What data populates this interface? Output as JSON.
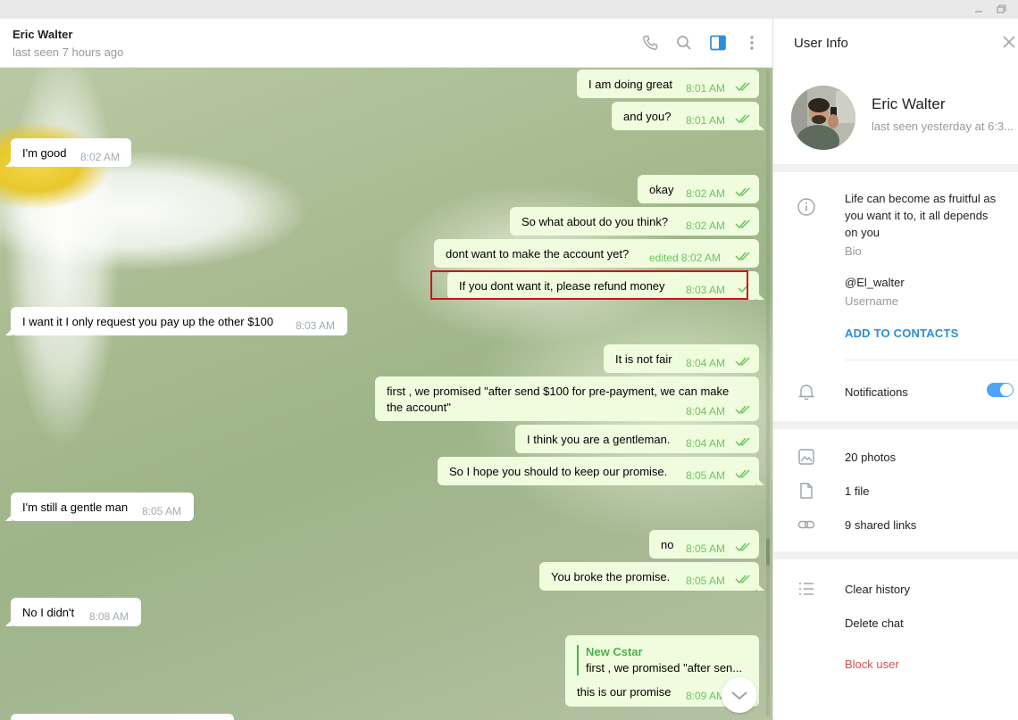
{
  "window": {
    "minimize_icon": "minimize-icon",
    "restore_icon": "restore-icon"
  },
  "chat_header": {
    "name": "Eric Walter",
    "status": "last seen 7 hours ago",
    "icons": [
      "phone-icon",
      "search-icon",
      "sidebar-toggle-icon",
      "more-vertical-icon"
    ]
  },
  "messages": [
    {
      "dir": "out",
      "text": "I am doing great",
      "time": "8:01 AM",
      "read": true
    },
    {
      "dir": "out",
      "text": "and  you?",
      "time": "8:01 AM",
      "read": true
    },
    {
      "dir": "in",
      "text": "I'm good",
      "time": "8:02 AM"
    },
    {
      "dir": "out",
      "text": "okay",
      "time": "8:02 AM",
      "read": true
    },
    {
      "dir": "out",
      "text": "So what about do you think?",
      "time": "8:02 AM",
      "read": true
    },
    {
      "dir": "out",
      "text": "dont want to make the account yet?",
      "time": "edited 8:02 AM",
      "read": true
    },
    {
      "dir": "out",
      "text": "If you dont want it, please refund money",
      "time": "8:03 AM",
      "read": false
    },
    {
      "dir": "in",
      "text": "I want it I only request you pay up the other $100",
      "time": "8:03 AM"
    },
    {
      "dir": "out",
      "text": "It is not fair",
      "time": "8:04 AM",
      "read": true
    },
    {
      "dir": "out",
      "text_line1": "first , we promised \"after send $100  for pre-payment, we can make",
      "text_line2": "the account\"",
      "time": "8:04 AM",
      "read": true
    },
    {
      "dir": "out",
      "text": "I think you are a gentleman.",
      "time": "8:04 AM",
      "read": true
    },
    {
      "dir": "out",
      "text": "So I hope you should to keep our promise.",
      "time": "8:05 AM",
      "read": true
    },
    {
      "dir": "in",
      "text": "I'm still a gentle man",
      "time": "8:05 AM"
    },
    {
      "dir": "out",
      "text": "no",
      "time": "8:05 AM",
      "read": true
    },
    {
      "dir": "out",
      "text": "You broke the promise.",
      "time": "8:05 AM",
      "read": true
    },
    {
      "dir": "in",
      "text": "No I didn't",
      "time": "8:08 AM"
    },
    {
      "dir": "out",
      "reply_name": "New Cstar",
      "reply_text": "first , we promised \"after sen...",
      "text": "this is our promise",
      "time": "8:09 AM",
      "read": true
    }
  ],
  "user_info": {
    "title": "User Info",
    "name": "Eric Walter",
    "last_seen": "last seen yesterday at 6:3...",
    "bio_line1": "Life can become as fruitful as",
    "bio_line2": "you want it to, it all depends",
    "bio_line3": "on you",
    "bio_label": "Bio",
    "username": "@El_walter",
    "username_label": "Username",
    "add_contacts": "ADD TO CONTACTS",
    "notifications_label": "Notifications",
    "notifications_on": true,
    "photos": "20 photos",
    "files": "1 file",
    "links": "9 shared links",
    "clear_history": "Clear history",
    "delete_chat": "Delete chat",
    "block_user": "Block user"
  },
  "colors": {
    "accent": "#2b8ed7",
    "outgoing_bubble": "#effdde",
    "time_green": "#6cc264",
    "danger": "#d14e4e",
    "highlight": "#d0121b"
  }
}
